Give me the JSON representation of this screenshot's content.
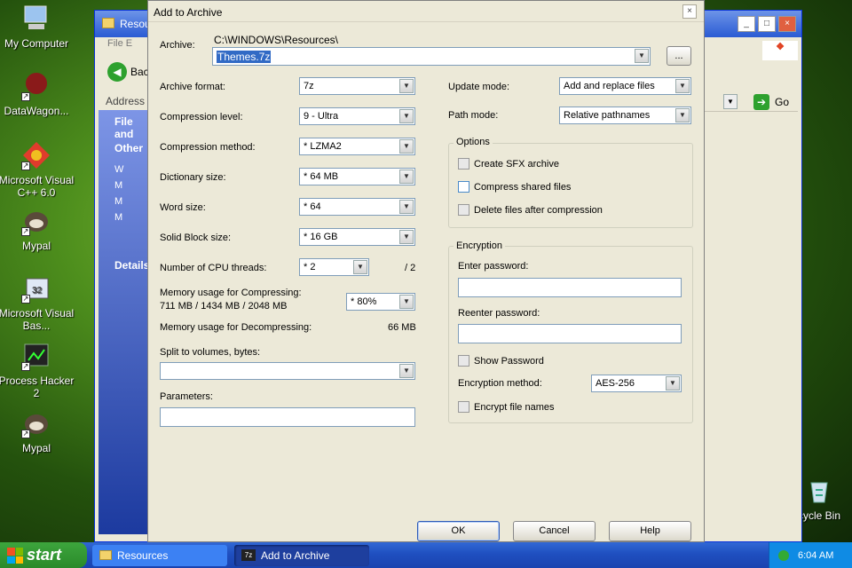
{
  "desktop": {
    "icons": [
      {
        "label": "My Computer"
      },
      {
        "label": "DataWagon..."
      },
      {
        "label": "Microsoft Visual C++ 6.0"
      },
      {
        "label": "Mypal"
      },
      {
        "label": "Microsoft Visual Bas..."
      },
      {
        "label": "Process Hacker 2"
      },
      {
        "label": "Mypal"
      },
      {
        "label": "cycle Bin"
      }
    ]
  },
  "explorer": {
    "title": "Resou",
    "menu": "File   E",
    "back_label": "Bac",
    "address_label": "Address",
    "go_label": "Go",
    "side": {
      "file_and": "File and",
      "other": "Other",
      "details": "Details"
    },
    "items": [
      "W",
      "M",
      "M",
      "M"
    ]
  },
  "dialog": {
    "title": "Add to Archive",
    "close": "×",
    "archive_label": "Archive:",
    "archive_path": "C:\\WINDOWS\\Resources\\",
    "archive_name": "Themes.7z",
    "browse": "...",
    "archive_format_label": "Archive format:",
    "archive_format": "7z",
    "compression_level_label": "Compression level:",
    "compression_level": "9 - Ultra",
    "compression_method_label": "Compression method:",
    "compression_method": "* LZMA2",
    "dictionary_size_label": "Dictionary size:",
    "dictionary_size": "* 64 MB",
    "word_size_label": "Word size:",
    "word_size": "* 64",
    "solid_block_label": "Solid Block size:",
    "solid_block": "* 16 GB",
    "cpu_threads_label": "Number of CPU threads:",
    "cpu_threads": "* 2",
    "cpu_threads_max": "/ 2",
    "mem_compress_label": "Memory usage for Compressing:",
    "mem_compress_values": "711 MB / 1434 MB / 2048 MB",
    "mem_compress_pct": "* 80%",
    "mem_decompress_label": "Memory usage for Decompressing:",
    "mem_decompress_value": "66 MB",
    "split_label": "Split to volumes, bytes:",
    "split_value": "",
    "parameters_label": "Parameters:",
    "parameters_value": "",
    "update_mode_label": "Update mode:",
    "update_mode": "Add and replace files",
    "path_mode_label": "Path mode:",
    "path_mode": "Relative pathnames",
    "options_title": "Options",
    "opt_sfx": "Create SFX archive",
    "opt_shared": "Compress shared files",
    "opt_delete": "Delete files after compression",
    "encryption_title": "Encryption",
    "enter_password_label": "Enter password:",
    "reenter_password_label": "Reenter password:",
    "show_password": "Show Password",
    "enc_method_label": "Encryption method:",
    "enc_method": "AES-256",
    "encrypt_names": "Encrypt file names",
    "ok": "OK",
    "cancel": "Cancel",
    "help": "Help"
  },
  "taskbar": {
    "start": "start",
    "tasks": [
      {
        "label": "Resources"
      },
      {
        "label": "Add to Archive"
      }
    ],
    "clock": "6:04 AM"
  },
  "colors": {
    "accent": "#2a5bd3",
    "dialog_bg": "#ece9d8",
    "selection": "#316ac5"
  }
}
